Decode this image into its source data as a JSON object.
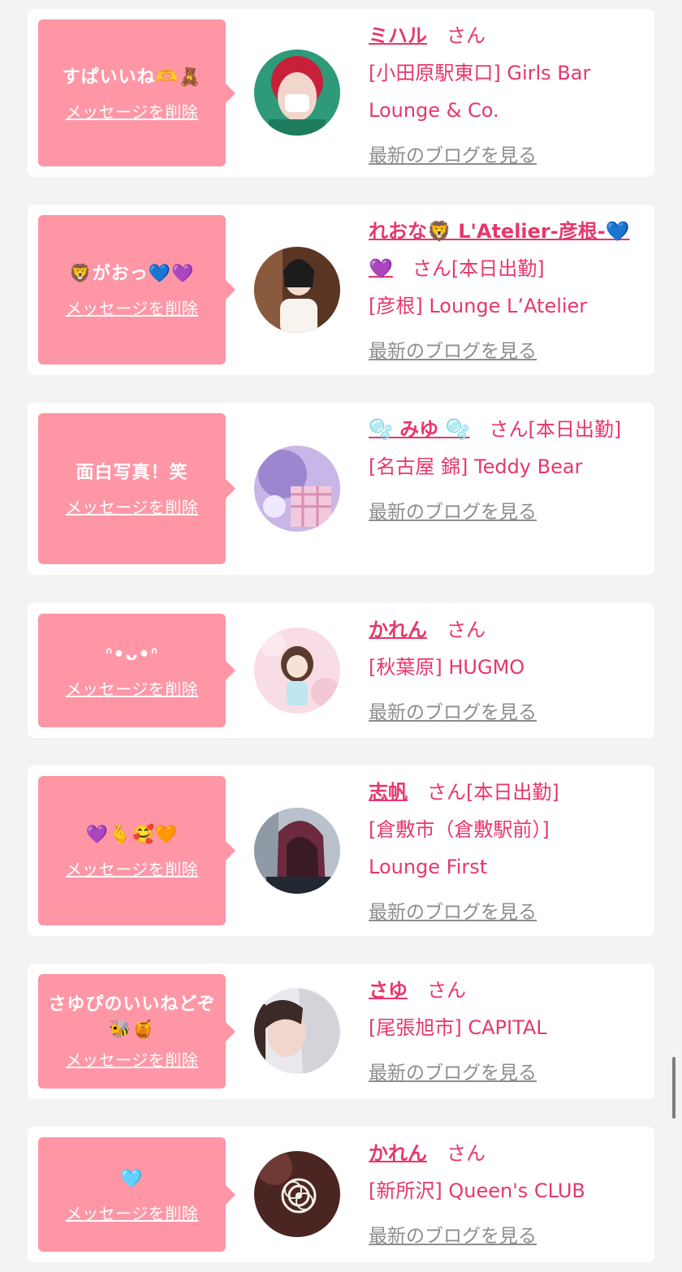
{
  "cards": [
    {
      "message": "すぱいいね🫶🧸",
      "delete_label": "メッセージを削除",
      "name": "ミハル",
      "san": "さん",
      "today": "",
      "shop": "[小田原駅東口] Girls Bar Lounge & Co.",
      "blog_label": "最新のブログを見る"
    },
    {
      "message": "🦁がおっ💙💜",
      "delete_label": "メッセージを削除",
      "name": "れおな🦁 L'Atelier-彦根-💙💜",
      "san": "さん",
      "today": "[本日出勤]",
      "shop": "[彦根] Lounge L’Atelier",
      "blog_label": "最新のブログを見る"
    },
    {
      "message": "面白写真！笑",
      "delete_label": "メッセージを削除",
      "name": "🫧 みゆ 🫧",
      "san": "さん",
      "today": "[本日出勤]",
      "shop": "[名古屋 錦] Teddy Bear",
      "blog_label": "最新のブログを見る"
    },
    {
      "message": "ᐢ•ᴗ•ᐢ",
      "delete_label": "メッセージを削除",
      "name": "かれん",
      "san": "さん",
      "today": "",
      "shop": "[秋葉原] HUGMO",
      "blog_label": "最新のブログを見る"
    },
    {
      "message": "💜🫰🥰🧡",
      "delete_label": "メッセージを削除",
      "name": "志帆",
      "san": "さん",
      "today": "[本日出勤]",
      "shop": "[倉敷市（倉敷駅前）] Lounge First",
      "blog_label": "最新のブログを見る"
    },
    {
      "message": "さゆぴのいいねどぞ🐝🍯",
      "delete_label": "メッセージを削除",
      "name": "さゆ",
      "san": "さん",
      "today": "",
      "shop": "[尾張旭市] CAPITAL",
      "blog_label": "最新のブログを見る"
    },
    {
      "message": "🩵",
      "delete_label": "メッセージを削除",
      "name": "かれん",
      "san": "さん",
      "today": "",
      "shop": "[新所沢] Queen's CLUB",
      "blog_label": "最新のブログを見る"
    }
  ],
  "colors": {
    "accent": "#e7376c",
    "bubble": "#fe96a6",
    "link_gray": "#8d8d8d",
    "background": "#f3f3f3"
  }
}
